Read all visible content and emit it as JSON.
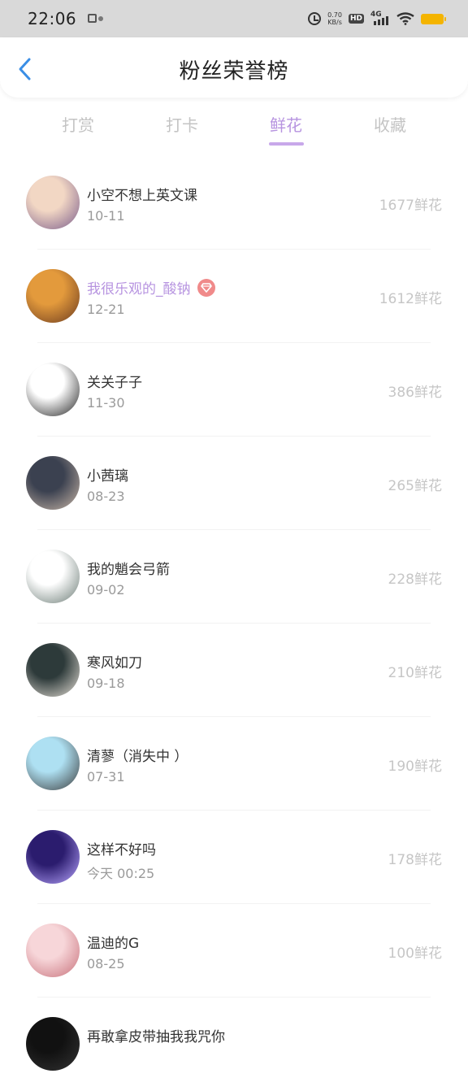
{
  "status_bar": {
    "time": "22:06",
    "net_speed_value": "0.70",
    "net_speed_unit": "KB/s",
    "hd_label": "HD",
    "network_label": "4G"
  },
  "header": {
    "title": "粉丝荣誉榜"
  },
  "tabs": [
    {
      "label": "打赏",
      "active": false
    },
    {
      "label": "打卡",
      "active": false
    },
    {
      "label": "鲜花",
      "active": true
    },
    {
      "label": "收藏",
      "active": false
    }
  ],
  "list": [
    {
      "name": "小空不想上英文课",
      "date": "10-11",
      "amount": "1677鲜花",
      "vip": false,
      "avatar_colors": [
        "#f2d7c4",
        "#7a5c8a"
      ]
    },
    {
      "name": "我很乐观的_酸钠",
      "date": "12-21",
      "amount": "1612鲜花",
      "vip": true,
      "avatar_colors": [
        "#e39a3c",
        "#6b3a1f"
      ]
    },
    {
      "name": "关关子子",
      "date": "11-30",
      "amount": "386鲜花",
      "vip": false,
      "avatar_colors": [
        "#ffffff",
        "#222222"
      ]
    },
    {
      "name": "小茜璃",
      "date": "08-23",
      "amount": "265鲜花",
      "vip": false,
      "avatar_colors": [
        "#3b4150",
        "#c9b7a8"
      ]
    },
    {
      "name": "我的魈会弓箭",
      "date": "09-02",
      "amount": "228鲜花",
      "vip": false,
      "avatar_colors": [
        "#ffffff",
        "#6a7a74"
      ]
    },
    {
      "name": "寒风如刀",
      "date": "09-18",
      "amount": "210鲜花",
      "vip": false,
      "avatar_colors": [
        "#2d3a3a",
        "#e8e1d8"
      ]
    },
    {
      "name": "清蓼（消失中 ）",
      "date": "07-31",
      "amount": "190鲜花",
      "vip": false,
      "avatar_colors": [
        "#aee0f2",
        "#3a3a3a"
      ]
    },
    {
      "name": "这样不好吗",
      "date": "今天 00:25",
      "amount": "178鲜花",
      "vip": false,
      "avatar_colors": [
        "#2b1c6e",
        "#b9a6ff"
      ]
    },
    {
      "name": "温迪的G",
      "date": "08-25",
      "amount": "100鲜花",
      "vip": false,
      "avatar_colors": [
        "#f7d6d9",
        "#c7707a"
      ]
    },
    {
      "name": "再敢拿皮带抽我我咒你",
      "date": "",
      "amount": "",
      "vip": false,
      "avatar_colors": [
        "#111111",
        "#333333"
      ]
    }
  ],
  "colors": {
    "accent": "#b794e0",
    "amount": "#c6c6c6",
    "back_arrow": "#3a8ee6",
    "vip_badge": "#f08a8a"
  }
}
